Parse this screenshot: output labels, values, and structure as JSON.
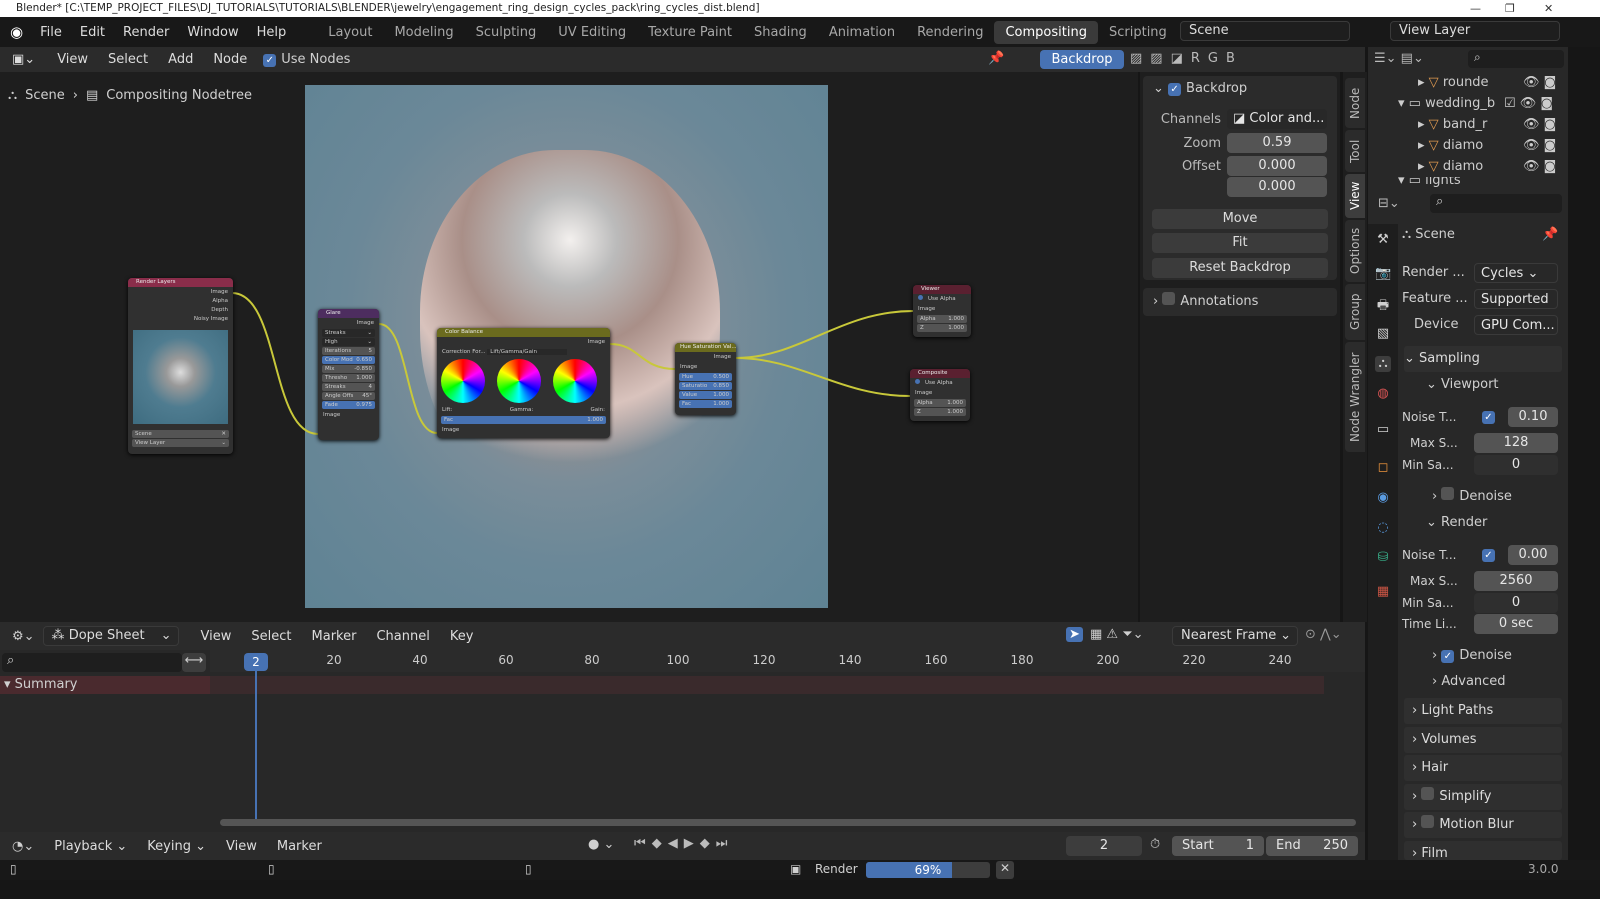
{
  "title_bar": {
    "text": "Blender* [C:\\TEMP_PROJECT_FILES\\DJ_TUTORIALS\\TUTORIALS\\BLENDER\\jewelry\\engagement_ring_design_cycles_pack\\ring_cycles_dist.blend]"
  },
  "menu": [
    "File",
    "Edit",
    "Render",
    "Window",
    "Help"
  ],
  "workspaces": [
    "Layout",
    "Modeling",
    "Sculpting",
    "UV Editing",
    "Texture Paint",
    "Shading",
    "Animation",
    "Rendering",
    "Compositing",
    "Scripting"
  ],
  "active_workspace": "Compositing",
  "scene_field": "Scene",
  "view_layer_field": "View Layer",
  "node_header": {
    "items": [
      "View",
      "Select",
      "Add",
      "Node"
    ],
    "use_nodes": "Use Nodes",
    "backdrop": "Backdrop",
    "channels": [
      "R",
      "G",
      "B"
    ]
  },
  "breadcrumb": [
    "Scene",
    "Compositing Nodetree"
  ],
  "nodes": {
    "render_layers": {
      "title": "Render Layers",
      "outputs": [
        "Image",
        "Alpha",
        "Depth",
        "Noisy Image"
      ],
      "scene": "Scene",
      "view_layer": "View Layer"
    },
    "glare": {
      "title": "Glare",
      "output": "Image",
      "type": "Streaks",
      "quality": "High",
      "fields": [
        [
          "Iterations",
          "5"
        ],
        [
          "Color Mod",
          "0.650"
        ],
        [
          "Mix",
          "-0.850"
        ],
        [
          "Thresho",
          "1.000"
        ],
        [
          "Streaks",
          "4"
        ],
        [
          "Angle Offs",
          "45°"
        ],
        [
          "Fade",
          "0.975"
        ]
      ],
      "input": "Image"
    },
    "color_balance": {
      "title": "Color Balance",
      "output": "Image",
      "correction_label": "Correction For...",
      "correction": "Lift/Gamma/Gain",
      "lift": "Lift:",
      "gamma": "Gamma:",
      "gain": "Gain:",
      "fac": "Fac",
      "fac_value": "1.000",
      "input": "Image"
    },
    "hsv": {
      "title": "Hue Saturation Val...",
      "output": "Image",
      "input": "Image",
      "fields": [
        [
          "Hue",
          "0.500"
        ],
        [
          "Saturatio",
          "0.850"
        ],
        [
          "Value",
          "1.000"
        ],
        [
          "Fac",
          "1.000"
        ]
      ]
    },
    "viewer": {
      "title": "Viewer",
      "use_alpha": "Use Alpha",
      "input": "Image",
      "fields": [
        [
          "Alpha",
          "1.000"
        ],
        [
          "Z",
          "1.000"
        ]
      ]
    },
    "composite": {
      "title": "Composite",
      "use_alpha": "Use Alpha",
      "input": "Image",
      "fields": [
        [
          "Alpha",
          "1.000"
        ],
        [
          "Z",
          "1.000"
        ]
      ]
    }
  },
  "npanel": {
    "backdrop": "Backdrop",
    "channels_label": "Channels",
    "channels": "Color and...",
    "zoom_label": "Zoom",
    "zoom": "0.59",
    "offset_label": "Offset",
    "offset_x": "0.000",
    "offset_y": "0.000",
    "move": "Move",
    "fit": "Fit",
    "reset": "Reset Backdrop",
    "annotations": "Annotations"
  },
  "side_tabs": [
    "Node",
    "Tool",
    "View",
    "Options",
    "Group",
    "Node Wrangler"
  ],
  "outliner": [
    {
      "name": "rounde",
      "indent": 1
    },
    {
      "name": "wedding_b",
      "indent": 0
    },
    {
      "name": "band_r",
      "indent": 1
    },
    {
      "name": "diamo",
      "indent": 1
    },
    {
      "name": "diamo",
      "indent": 1
    },
    {
      "name": "lights",
      "indent": 0
    }
  ],
  "properties": {
    "context": "Scene",
    "render_engine_label": "Render ...",
    "render_engine": "Cycles",
    "feature_label": "Feature ...",
    "feature": "Supported",
    "device_label": "Device",
    "device": "GPU Com...",
    "sampling": "Sampling",
    "viewport": "Viewport",
    "vp_noise_label": "Noise T...",
    "vp_noise": "0.10",
    "vp_max_label": "Max S...",
    "vp_max": "128",
    "vp_min_label": "Min Sa...",
    "vp_min": "0",
    "denoise": "Denoise",
    "render": "Render",
    "r_noise_label": "Noise T...",
    "r_noise": "0.00",
    "r_max_label": "Max S...",
    "r_max": "2560",
    "r_min_label": "Min Sa...",
    "r_min": "0",
    "time_label": "Time Li...",
    "time": "0 sec",
    "advanced": "Advanced",
    "light_paths": "Light Paths",
    "volumes": "Volumes",
    "hair": "Hair",
    "simplify": "Simplify",
    "motion_blur": "Motion Blur",
    "film": "Film"
  },
  "dopesheet": {
    "mode": "Dope Sheet",
    "items": [
      "View",
      "Select",
      "Marker",
      "Channel",
      "Key"
    ],
    "snap": "Nearest Frame",
    "current_frame": "2",
    "ticks": [
      "20",
      "40",
      "60",
      "80",
      "100",
      "120",
      "140",
      "160",
      "180",
      "200",
      "220",
      "240"
    ],
    "summary": "Summary"
  },
  "timeline": {
    "items": [
      "Playback",
      "Keying",
      "View",
      "Marker"
    ],
    "frame": "2",
    "start_label": "Start",
    "start": "1",
    "end_label": "End",
    "end": "250"
  },
  "status": {
    "render_label": "Render",
    "progress_text": "69%",
    "progress": 0.69,
    "version": "3.0.0"
  }
}
